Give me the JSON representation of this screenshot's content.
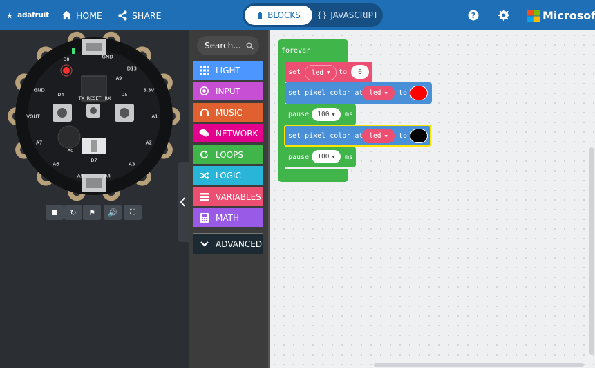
{
  "header": {
    "logo_text": "adafruit",
    "home_label": "HOME",
    "share_label": "SHARE",
    "blocks_label": "BLOCKS",
    "javascript_label": "JAVASCRIPT",
    "microsoft_label": "Microsoft"
  },
  "simulator": {
    "board_labels": [
      "GND",
      "D13",
      "3.3V",
      "A1",
      "A2",
      "A3",
      "A4",
      "A5",
      "A6",
      "A7",
      "VOUT",
      "GND",
      "TX",
      "RX",
      "RESET",
      "D4",
      "D5",
      "D7",
      "A0",
      "A9",
      "D8"
    ],
    "controls": [
      "stop",
      "restart",
      "fast",
      "sound",
      "fullscreen"
    ]
  },
  "toolbox": {
    "search_placeholder": "Search...",
    "categories": [
      {
        "label": "LIGHT",
        "color": "#4c97ff",
        "icon": "grid-icon"
      },
      {
        "label": "INPUT",
        "color": "#c74fd4",
        "icon": "target-icon"
      },
      {
        "label": "MUSIC",
        "color": "#e0612f",
        "icon": "headphones-icon"
      },
      {
        "label": "NETWORK",
        "color": "#e3008c",
        "icon": "chat-icon"
      },
      {
        "label": "LOOPS",
        "color": "#3fb54a",
        "icon": "refresh-icon"
      },
      {
        "label": "LOGIC",
        "color": "#29b5d8",
        "icon": "shuffle-icon"
      },
      {
        "label": "VARIABLES",
        "color": "#ec4f71",
        "icon": "list-icon"
      },
      {
        "label": "MATH",
        "color": "#9a5ae8",
        "icon": "calculator-icon"
      }
    ],
    "advanced_label": "ADVANCED"
  },
  "workspace": {
    "forever_label": "forever",
    "set_label": "set",
    "var_name": "led",
    "to_label": "to",
    "set_value": "0",
    "pixel_label": "set pixel color at",
    "pixel_var": "led",
    "pixel_to": "to",
    "color1": "#ff0000",
    "color2": "#000000",
    "pause_label": "pause",
    "pause_value1": "100",
    "pause_value2": "100",
    "ms_label": "ms"
  }
}
